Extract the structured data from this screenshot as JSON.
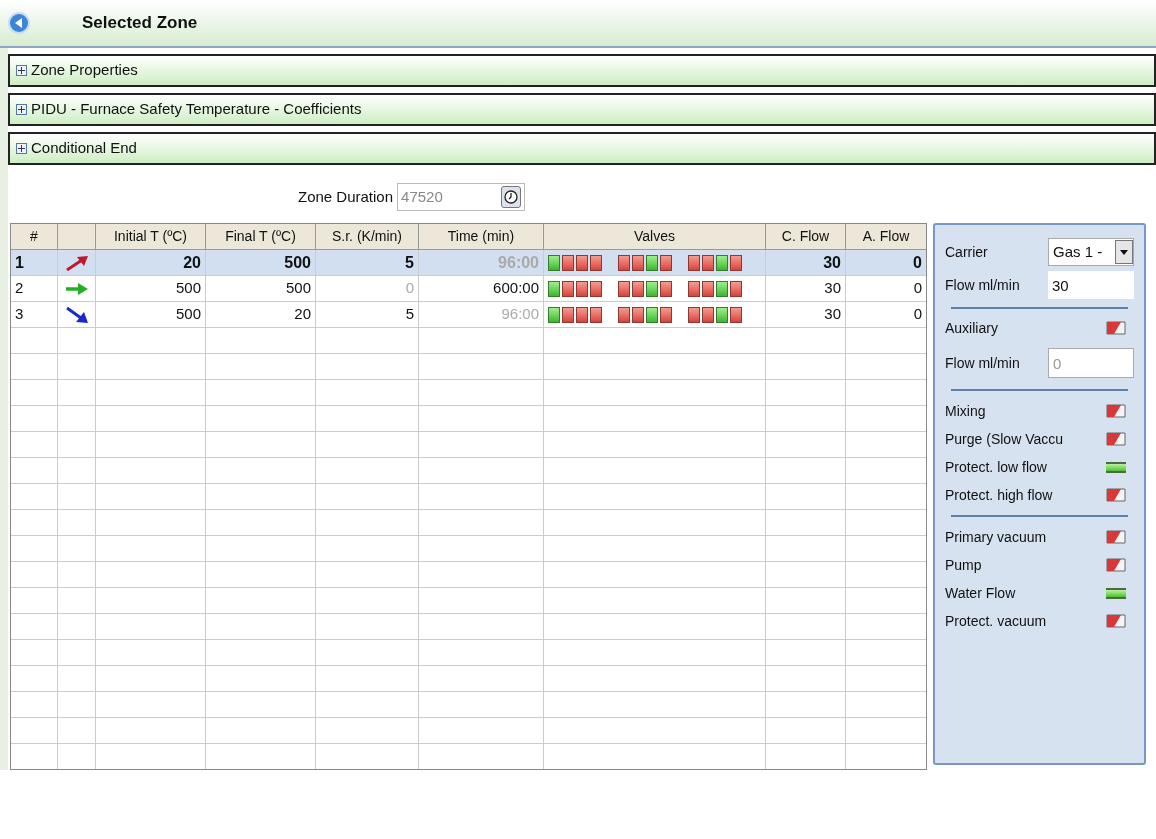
{
  "header": {
    "title": "Selected Zone"
  },
  "sections": [
    {
      "label": "Zone Properties",
      "expanded": false
    },
    {
      "label": "PIDU - Furnace Safety Temperature - Coefficients",
      "expanded": false
    },
    {
      "label": "Conditional End",
      "expanded": false
    }
  ],
  "zone_duration": {
    "label": "Zone Duration",
    "value": "47520"
  },
  "table": {
    "columns": [
      "#",
      "",
      "Initial T (ºC)",
      "Final T (ºC)",
      "S.r. (K/min)",
      "Time (min)",
      "Valves",
      "C. Flow",
      "A. Flow"
    ],
    "rows": [
      {
        "number": "1",
        "kind": "ramp_up",
        "selected": true,
        "initial_t": "20",
        "final_t": "500",
        "rate": "5",
        "rate_dimmed": false,
        "time": "96:00",
        "time_dimmed": true,
        "valves": [
          true,
          false,
          false,
          false,
          false,
          false,
          true,
          false,
          false,
          false,
          true,
          false
        ],
        "c_flow": "30",
        "a_flow": "0"
      },
      {
        "number": "2",
        "kind": "hold",
        "selected": false,
        "initial_t": "500",
        "final_t": "500",
        "rate": "0",
        "rate_dimmed": true,
        "time": "600:00",
        "time_dimmed": false,
        "valves": [
          true,
          false,
          false,
          false,
          false,
          false,
          true,
          false,
          false,
          false,
          true,
          false
        ],
        "c_flow": "30",
        "a_flow": "0"
      },
      {
        "number": "3",
        "kind": "ramp_down",
        "selected": false,
        "initial_t": "500",
        "final_t": "20",
        "rate": "5",
        "rate_dimmed": false,
        "time": "96:00",
        "time_dimmed": true,
        "valves": [
          true,
          false,
          false,
          false,
          false,
          false,
          true,
          false,
          false,
          false,
          true,
          false
        ],
        "c_flow": "30",
        "a_flow": "0"
      }
    ]
  },
  "panel": {
    "carrier": {
      "label": "Carrier",
      "value": "Gas 1 -"
    },
    "carrier_flow": {
      "label": "Flow ml/min",
      "value": "30"
    },
    "auxiliary": {
      "label": "Auxiliary",
      "on": false
    },
    "auxiliary_flow": {
      "label": "Flow ml/min",
      "placeholder": "0"
    },
    "groups": [
      [
        {
          "label": "Mixing",
          "on": false
        },
        {
          "label": "Purge (Slow Vaccu",
          "on": false
        },
        {
          "label": "Protect. low flow",
          "on": true
        },
        {
          "label": "Protect. high flow",
          "on": false
        }
      ],
      [
        {
          "label": "Primary vacuum",
          "on": false
        },
        {
          "label": "Pump",
          "on": false
        },
        {
          "label": "Water Flow",
          "on": true
        },
        {
          "label": "Protect. vacuum",
          "on": false
        }
      ]
    ]
  }
}
